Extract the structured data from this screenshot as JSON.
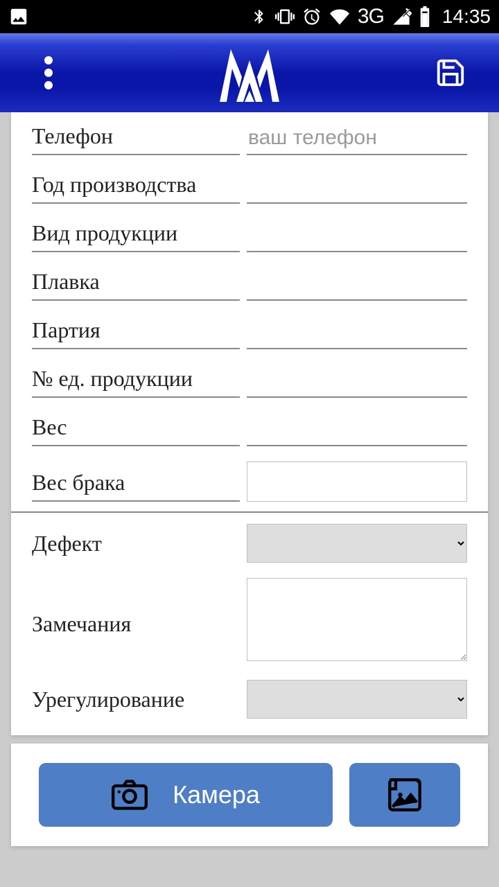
{
  "status": {
    "time": "14:35",
    "network_label": "3G"
  },
  "form": {
    "fields": [
      {
        "label": "Телефон",
        "placeholder": "ваш телефон"
      },
      {
        "label": "Год производства",
        "placeholder": ""
      },
      {
        "label": "Вид продукции",
        "placeholder": ""
      },
      {
        "label": "Плавка",
        "placeholder": ""
      },
      {
        "label": "Партия",
        "placeholder": ""
      },
      {
        "label": "№ ед. продукции",
        "placeholder": ""
      },
      {
        "label": "Вес",
        "placeholder": ""
      }
    ],
    "weight_defect_label": "Вес брака",
    "defect_label": "Дефект",
    "remarks_label": "Замечания",
    "settlement_label": "Урегулирование"
  },
  "buttons": {
    "camera": "Камера"
  }
}
